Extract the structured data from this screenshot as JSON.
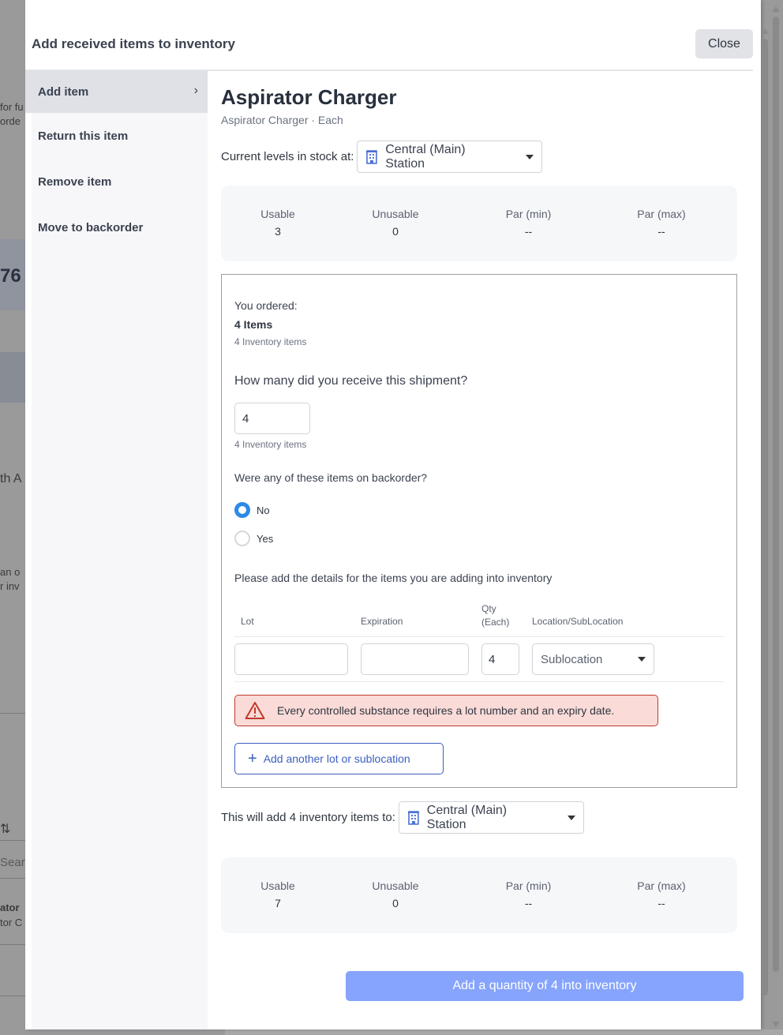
{
  "background": {
    "snippets": [
      "for fu",
      "orde",
      "76",
      "th A",
      "an o",
      "r inv",
      "Searc",
      "ator",
      "tor C"
    ]
  },
  "modal": {
    "title": "Add received items to inventory",
    "close_label": "Close"
  },
  "sidebar": {
    "items": [
      {
        "label": "Add item",
        "active": true
      },
      {
        "label": "Return this item"
      },
      {
        "label": "Remove item"
      },
      {
        "label": "Move to backorder"
      }
    ]
  },
  "item": {
    "name": "Aspirator Charger",
    "subtitle": "Aspirator Charger · Each"
  },
  "stock": {
    "label": "Current levels in stock at:",
    "location": "Central (Main) Station",
    "levels": [
      {
        "label": "Usable",
        "value": "3"
      },
      {
        "label": "Unusable",
        "value": "0"
      },
      {
        "label": "Par (min)",
        "value": "--"
      },
      {
        "label": "Par (max)",
        "value": "--"
      }
    ]
  },
  "order": {
    "ordered_label": "You ordered:",
    "ordered_items": "4 Items",
    "ordered_inventory": "4 Inventory items",
    "received_question": "How many did you receive this shipment?",
    "received_value": "4",
    "received_inventory": "4 Inventory items",
    "backorder_question": "Were any of these items on backorder?",
    "backorder_options": [
      {
        "label": "No",
        "checked": true
      },
      {
        "label": "Yes",
        "checked": false
      }
    ],
    "details_prompt": "Please add the details for the items you are adding into inventory",
    "columns": {
      "lot": "Lot",
      "expiration": "Expiration",
      "qty": "Qty",
      "qty_unit": "(Each)",
      "location": "Location/SubLocation"
    },
    "row": {
      "lot": "",
      "expiration": "",
      "qty": "4",
      "sublocation_placeholder": "Sublocation"
    },
    "alert": "Every controlled substance requires a lot number and an expiry date.",
    "add_lot_label": "Add another lot or sublocation"
  },
  "destination": {
    "label": "This will add 4 inventory items to:",
    "location": "Central (Main) Station",
    "levels": [
      {
        "label": "Usable",
        "value": "7"
      },
      {
        "label": "Unusable",
        "value": "0"
      },
      {
        "label": "Par (min)",
        "value": "--"
      },
      {
        "label": "Par (max)",
        "value": "--"
      }
    ]
  },
  "submit_label": "Add a quantity of 4 into inventory",
  "colors": {
    "accent": "#2b8ae8",
    "primary_disabled": "#86a4fc",
    "alert_bg": "#fadbd8",
    "alert_border": "#c0392b",
    "link_blue": "#3c5fbf"
  }
}
